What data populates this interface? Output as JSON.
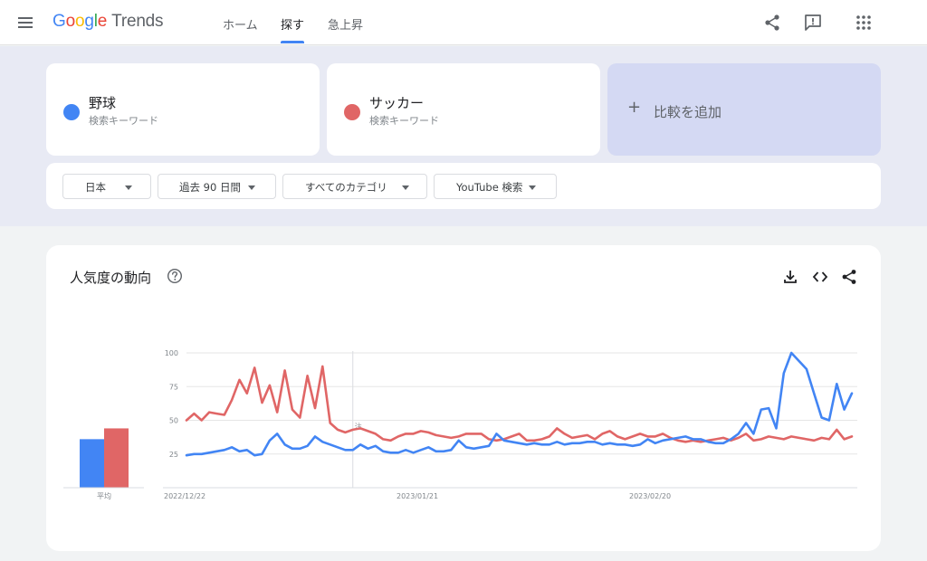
{
  "header": {
    "logo": {
      "google_letters": [
        {
          "ch": "G",
          "color": "#4285f4"
        },
        {
          "ch": "o",
          "color": "#ea4335"
        },
        {
          "ch": "o",
          "color": "#fbbc05"
        },
        {
          "ch": "g",
          "color": "#4285f4"
        },
        {
          "ch": "l",
          "color": "#34a853"
        },
        {
          "ch": "e",
          "color": "#ea4335"
        }
      ],
      "product": "Trends"
    },
    "tabs": [
      {
        "label": "ホーム",
        "active": false
      },
      {
        "label": "探す",
        "active": true
      },
      {
        "label": "急上昇",
        "active": false
      }
    ],
    "icons": [
      "menu-icon",
      "share-icon",
      "feedback-icon",
      "apps-icon"
    ]
  },
  "terms": [
    {
      "name": "野球",
      "sub": "検索キーワード",
      "color": "#4285f4"
    },
    {
      "name": "サッカー",
      "sub": "検索キーワード",
      "color": "#e06666"
    }
  ],
  "add_compare": {
    "plus": "+",
    "label": "比較を追加"
  },
  "filters": [
    {
      "label": "日本"
    },
    {
      "label": "過去 90 日間"
    },
    {
      "label": "すべてのカテゴリ"
    },
    {
      "label": "YouTube 検索"
    }
  ],
  "interest_card": {
    "title": "人気度の動向",
    "icons": [
      "help-icon",
      "download-icon",
      "embed-icon",
      "share-icon"
    ]
  },
  "chart_data": {
    "type": "line",
    "x": [
      "2022/12/22",
      "2023/01/21",
      "2023/02/20"
    ],
    "y_ticks": [
      100,
      75,
      50,
      25
    ],
    "ylim": [
      0,
      100
    ],
    "average_label": "平均",
    "averages": [
      {
        "term": "野球",
        "value": 36,
        "color": "#4285f4"
      },
      {
        "term": "サッカー",
        "value": 44,
        "color": "#e06666"
      }
    ],
    "annotation": {
      "index": 22,
      "marker": "注"
    },
    "series": [
      {
        "name": "野球",
        "color": "#4285f4",
        "values": [
          24,
          25,
          25,
          26,
          27,
          28,
          30,
          27,
          28,
          24,
          25,
          35,
          40,
          32,
          29,
          29,
          31,
          38,
          34,
          32,
          30,
          28,
          28,
          32,
          29,
          31,
          27,
          26,
          26,
          28,
          26,
          28,
          30,
          27,
          27,
          28,
          35,
          30,
          29,
          30,
          31,
          40,
          35,
          34,
          33,
          32,
          33,
          32,
          32,
          34,
          32,
          33,
          33,
          34,
          34,
          32,
          33,
          32,
          32,
          31,
          32,
          36,
          33,
          35,
          36,
          37,
          38,
          36,
          36,
          34,
          33,
          33,
          36,
          40,
          48,
          40,
          58,
          59,
          44,
          85,
          100,
          94,
          88,
          70,
          52,
          50,
          77,
          58,
          70
        ]
      },
      {
        "name": "サッカー",
        "color": "#e06666",
        "values": [
          50,
          55,
          50,
          56,
          55,
          54,
          65,
          80,
          70,
          89,
          63,
          76,
          56,
          87,
          58,
          52,
          83,
          59,
          90,
          48,
          43,
          41,
          43,
          44,
          42,
          40,
          36,
          35,
          38,
          40,
          40,
          42,
          41,
          39,
          38,
          37,
          38,
          40,
          40,
          40,
          36,
          35,
          36,
          38,
          40,
          35,
          35,
          36,
          38,
          44,
          40,
          37,
          38,
          39,
          36,
          40,
          42,
          38,
          36,
          38,
          40,
          38,
          38,
          40,
          37,
          35,
          34,
          35,
          34,
          35,
          36,
          37,
          35,
          37,
          40,
          35,
          36,
          38,
          37,
          36,
          38,
          37,
          36,
          35,
          37,
          36,
          43,
          36,
          38
        ]
      }
    ]
  }
}
